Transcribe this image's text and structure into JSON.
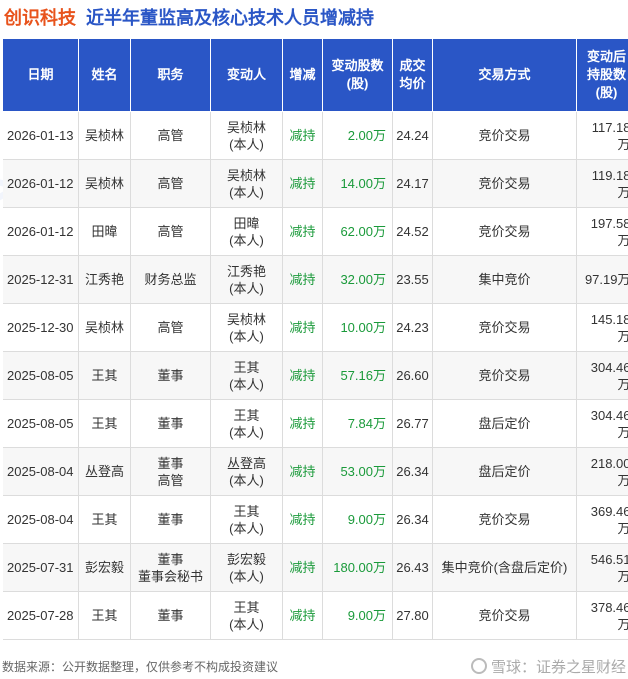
{
  "header": {
    "company": "创识科技",
    "title": "近半年董监高及核心技术人员增减持"
  },
  "table": {
    "columns": [
      [
        "日期"
      ],
      [
        "姓名"
      ],
      [
        "职务"
      ],
      [
        "变动人"
      ],
      [
        "增减"
      ],
      [
        "变动股数",
        "(股)"
      ],
      [
        "成交",
        "均价"
      ],
      [
        "交易方式"
      ],
      [
        "变动后",
        "持股数",
        "(股)"
      ]
    ],
    "rows": [
      {
        "date": "2026-01-13",
        "name": "吴桢林",
        "role": [
          "高管"
        ],
        "person": [
          "吴桢林",
          "(本人)"
        ],
        "dir": "减持",
        "shares": "2.00万",
        "price": "24.24",
        "method": "竞价交易",
        "after": "117.18万"
      },
      {
        "date": "2026-01-12",
        "name": "吴桢林",
        "role": [
          "高管"
        ],
        "person": [
          "吴桢林",
          "(本人)"
        ],
        "dir": "减持",
        "shares": "14.00万",
        "price": "24.17",
        "method": "竞价交易",
        "after": "119.18万"
      },
      {
        "date": "2026-01-12",
        "name": "田暐",
        "role": [
          "高管"
        ],
        "person": [
          "田暐",
          "(本人)"
        ],
        "dir": "减持",
        "shares": "62.00万",
        "price": "24.52",
        "method": "竞价交易",
        "after": "197.58万"
      },
      {
        "date": "2025-12-31",
        "name": "江秀艳",
        "role": [
          "财务总监"
        ],
        "person": [
          "江秀艳",
          "(本人)"
        ],
        "dir": "减持",
        "shares": "32.00万",
        "price": "23.55",
        "method": "集中竞价",
        "after": "97.19万"
      },
      {
        "date": "2025-12-30",
        "name": "吴桢林",
        "role": [
          "高管"
        ],
        "person": [
          "吴桢林",
          "(本人)"
        ],
        "dir": "减持",
        "shares": "10.00万",
        "price": "24.23",
        "method": "竞价交易",
        "after": "145.18万"
      },
      {
        "date": "2025-08-05",
        "name": "王其",
        "role": [
          "董事"
        ],
        "person": [
          "王其",
          "(本人)"
        ],
        "dir": "减持",
        "shares": "57.16万",
        "price": "26.60",
        "method": "竞价交易",
        "after": "304.46万"
      },
      {
        "date": "2025-08-05",
        "name": "王其",
        "role": [
          "董事"
        ],
        "person": [
          "王其",
          "(本人)"
        ],
        "dir": "减持",
        "shares": "7.84万",
        "price": "26.77",
        "method": "盘后定价",
        "after": "304.46万"
      },
      {
        "date": "2025-08-04",
        "name": "丛登高",
        "role": [
          "董事",
          "高管"
        ],
        "person": [
          "丛登高",
          "(本人)"
        ],
        "dir": "减持",
        "shares": "53.00万",
        "price": "26.34",
        "method": "盘后定价",
        "after": "218.00万"
      },
      {
        "date": "2025-08-04",
        "name": "王其",
        "role": [
          "董事"
        ],
        "person": [
          "王其",
          "(本人)"
        ],
        "dir": "减持",
        "shares": "9.00万",
        "price": "26.34",
        "method": "竞价交易",
        "after": "369.46万"
      },
      {
        "date": "2025-07-31",
        "name": "彭宏毅",
        "role": [
          "董事",
          "董事会秘书"
        ],
        "person": [
          "彭宏毅",
          "(本人)"
        ],
        "dir": "减持",
        "shares": "180.00万",
        "price": "26.43",
        "method": "集中竞价(含盘后定价)",
        "after": "546.51万"
      },
      {
        "date": "2025-07-28",
        "name": "王其",
        "role": [
          "董事"
        ],
        "person": [
          "王其",
          "(本人)"
        ],
        "dir": "减持",
        "shares": "9.00万",
        "price": "27.80",
        "method": "竞价交易",
        "after": "378.46万"
      }
    ]
  },
  "footer": {
    "source": "数据来源：公开数据整理，仅供参考不构成投资建议",
    "brand": "雪球：证券之星财经"
  },
  "watermark": {
    "text": "证券之星"
  },
  "colors": {
    "header_bg": "#2a56c6",
    "company": "#e8531c",
    "title": "#2a56c6",
    "change": "#1a9a3a"
  }
}
